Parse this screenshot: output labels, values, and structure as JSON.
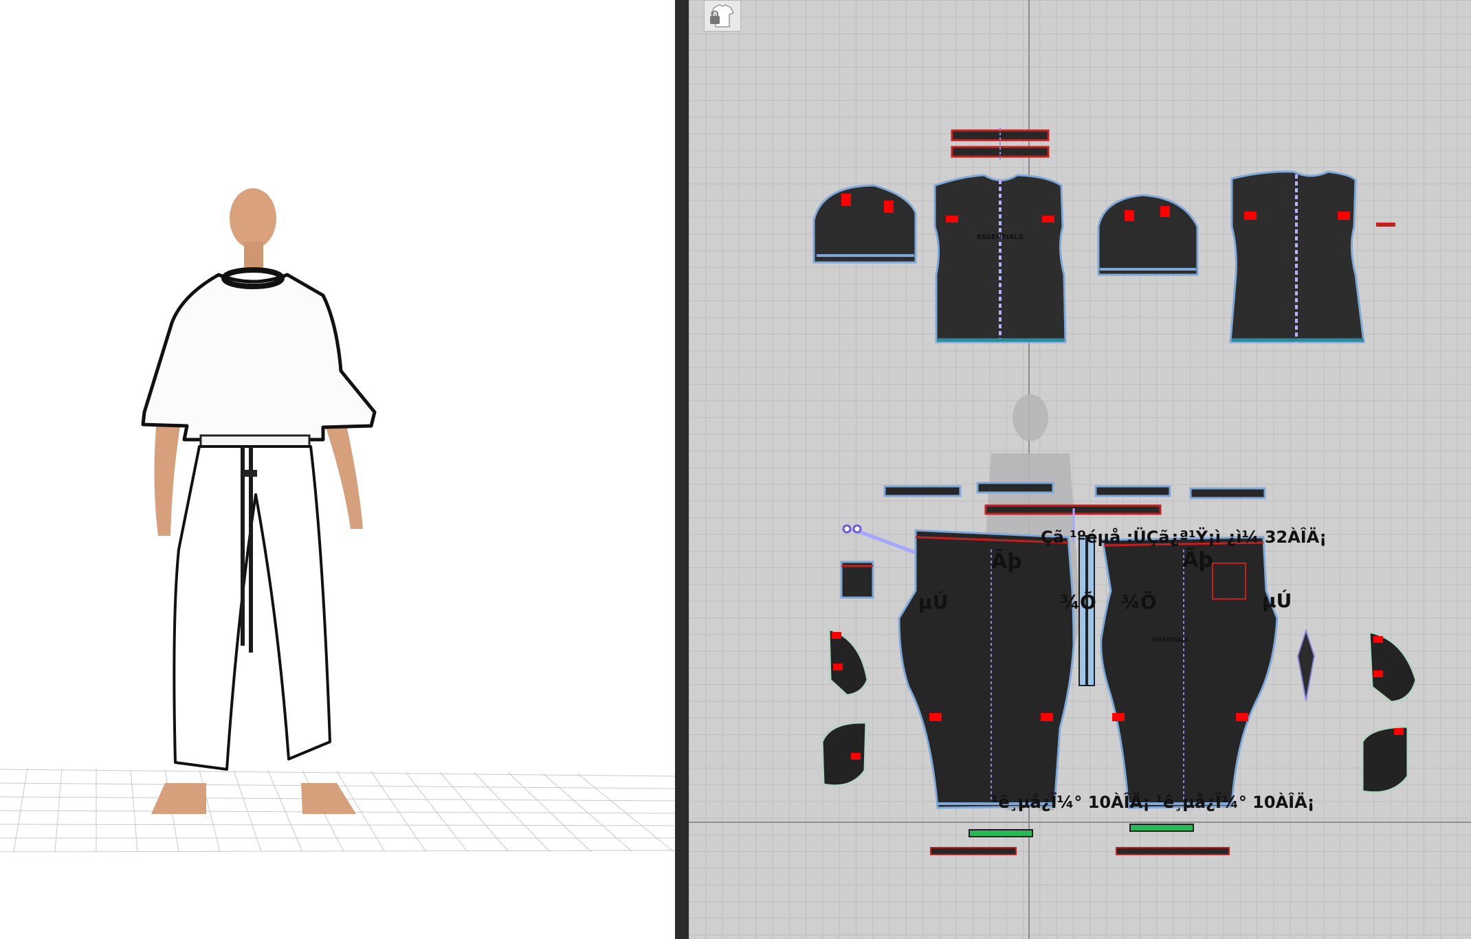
{
  "pattern_view": {
    "labels": {
      "front_texture": "ESSENTIALS",
      "pants_texture": "ESSENTIALS",
      "measure_top": "Çã ¹ºéµå :ÜÇã¿ª¹Ÿ¡ì ¿ì¼ 32ÀÎÄ¡",
      "measure_bottom": "¹ê¸µå¿Ï¼° 10ÀÎÄ¡ ¹ê¸µå¿Ï¼° 10ÀÎÄ¡",
      "left_front": "µÚ",
      "left_mid": "¾Õ",
      "right_mid": "¾Õ",
      "right_back": "µÚ",
      "pocket_left": "Ãþ",
      "pocket_right": "Ãþ"
    }
  },
  "colors": {
    "fabric": "#272727",
    "stitch": "#8a8ad8",
    "seam_red": "#c42020",
    "edge_blue": "#7fa9d9",
    "accent_green": "#27b85a",
    "teal_hem": "#2a8a9c"
  }
}
